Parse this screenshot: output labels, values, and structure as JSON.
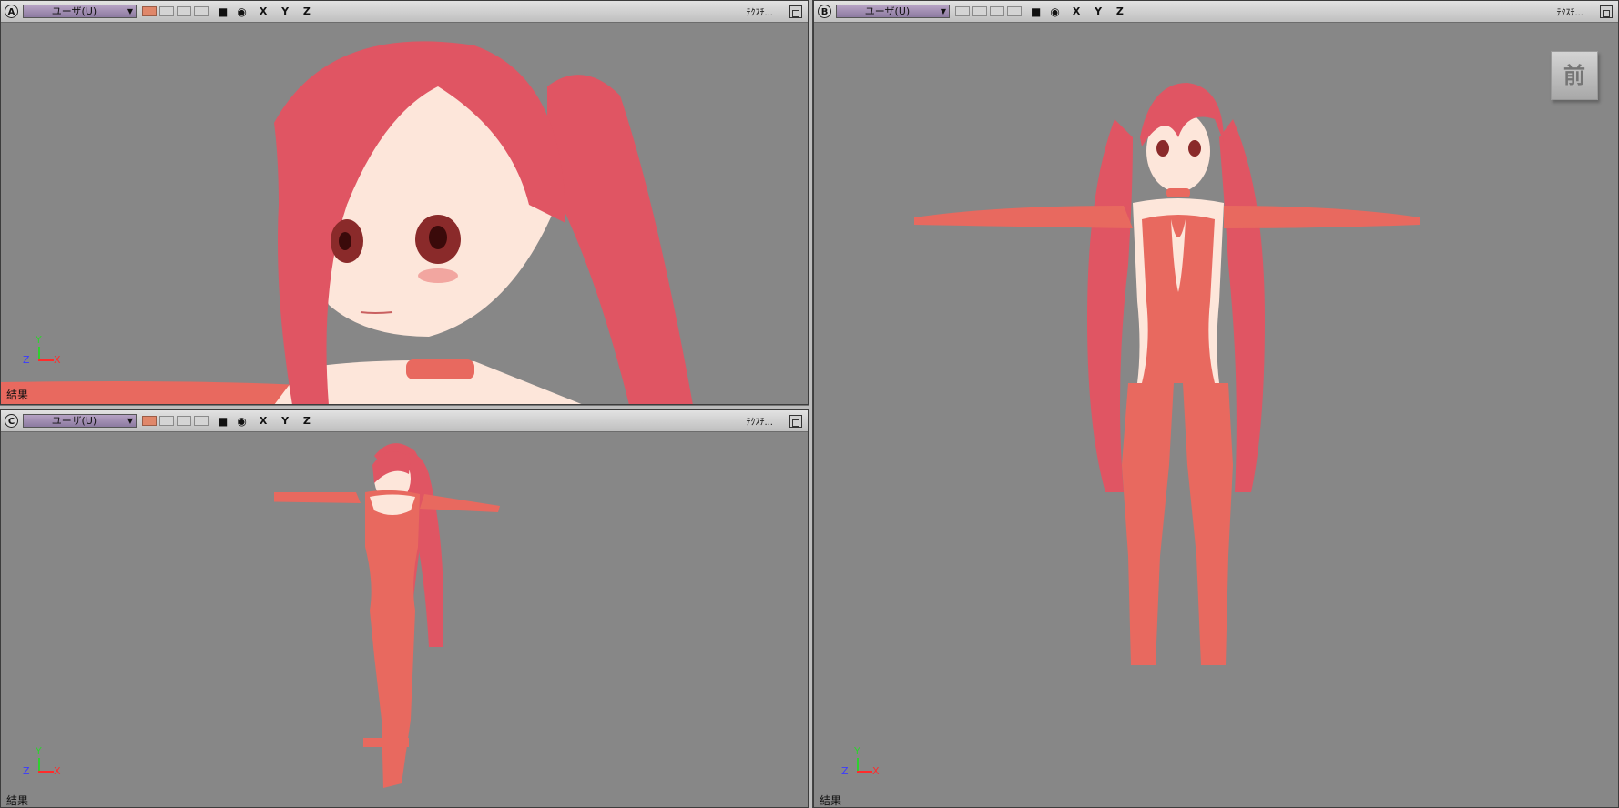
{
  "viewports": {
    "a": {
      "letter": "A",
      "view": "ユーザ(U)",
      "axes": "X Y Z",
      "texture": "ﾃｸｽﾁ...",
      "result": "結果"
    },
    "b": {
      "letter": "B",
      "view": "ユーザ(U)",
      "axes": "X Y Z",
      "texture": "ﾃｸｽﾁ...",
      "result": "結果",
      "cube_face": "前"
    },
    "c": {
      "letter": "C",
      "view": "ユーザ(U)",
      "axes": "X Y Z",
      "texture": "ﾃｸｽﾁ...",
      "result": "結果"
    }
  },
  "axis_labels": {
    "x": "X",
    "y": "Y",
    "z": "Z"
  },
  "colors": {
    "background": "#878787",
    "hair": "#e05563",
    "suit": "#e8695f",
    "skin": "#fde6da",
    "x_axis": "#ff2b2b",
    "y_axis": "#2fd02f",
    "z_axis": "#3b3bff"
  }
}
